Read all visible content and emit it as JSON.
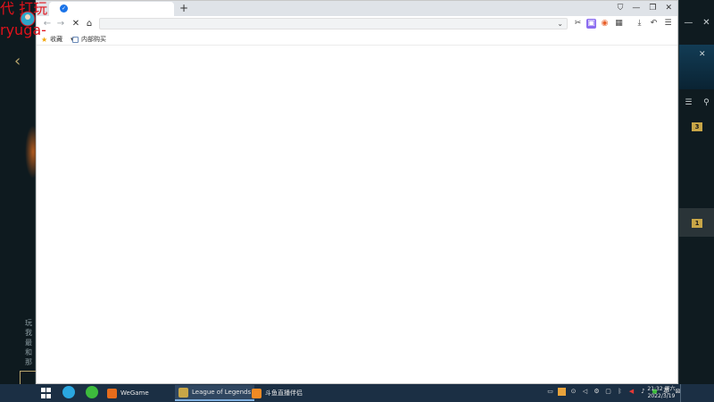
{
  "watermark": {
    "line1": "代 打玩",
    "line2": "ryuga-"
  },
  "lol": {
    "back_icon": "chevron-left-icon",
    "left_text": [
      "玩 ",
      "我 ",
      "最 ",
      "和 ",
      "那 "
    ],
    "right_top_icons": [
      "minimize-icon",
      "close-icon"
    ],
    "right_tool_icons": [
      "list-icon",
      "search-icon"
    ],
    "badges": [
      "3",
      "1"
    ],
    "colors": {
      "gold": "#c8a647",
      "teal": "#19a38a",
      "blue_band": "#123c55"
    }
  },
  "browser": {
    "tab_favicon": "browser-logo-icon",
    "new_tab_label": "+",
    "window_controls": [
      "shield-icon",
      "minimize-icon",
      "maximize-icon",
      "close-icon"
    ],
    "nav": {
      "back": "←",
      "forward": "→",
      "stop": "✕",
      "home": "⌂"
    },
    "address": {
      "value": "",
      "dropdown": "⌄"
    },
    "toolbar_icons": [
      "scissors-icon",
      "extension-icon",
      "gamepad-icon",
      "apps-grid-icon",
      "download-icon",
      "undo-icon",
      "menu-icon"
    ],
    "bookmarks": [
      {
        "label": "收藏",
        "icon": "star-icon",
        "has_dropdown": true,
        "dropdown": "▾"
      },
      {
        "label": "内部购买",
        "icon": "page-icon"
      }
    ]
  },
  "taskbar": {
    "items": [
      {
        "label": "WeGame",
        "icon_color": "#e66c1c",
        "active": false
      },
      {
        "label": "League of Legends",
        "icon_color": "#c8a647",
        "active": true
      },
      {
        "label": "斗鱼直播伴侣",
        "icon_color": "#f08a24",
        "active": false
      }
    ],
    "pinned": [
      {
        "name": "media-player-icon",
        "color": "#2aa7e0"
      },
      {
        "name": "app-green-icon",
        "color": "#3dbb3d"
      }
    ],
    "tray_icons": [
      "network-icon",
      "volume-icon",
      "ime-icon",
      "wechat-icon",
      "notification-icon"
    ],
    "clock": {
      "time": "21:32 周六",
      "date": "2022/3/19"
    }
  }
}
